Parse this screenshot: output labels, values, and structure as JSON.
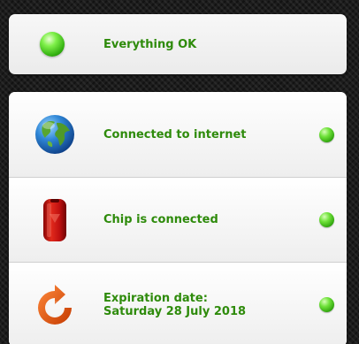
{
  "status": {
    "label": "Everything OK",
    "indicator_icon": "green-status-icon"
  },
  "items": [
    {
      "icon": "globe-icon",
      "label": "Connected to internet",
      "status_icon": "green-led-icon"
    },
    {
      "icon": "chip-icon",
      "label": "Chip is connected",
      "status_icon": "green-led-icon"
    },
    {
      "icon": "refresh-icon",
      "label_line1": "Expiration date:",
      "label_line2": "Saturday 28 July 2018",
      "status_icon": "green-led-icon"
    }
  ],
  "colors": {
    "text_green": "#2e8b0b",
    "led_green": "#3fbd16",
    "background": "#1c1c1c"
  }
}
